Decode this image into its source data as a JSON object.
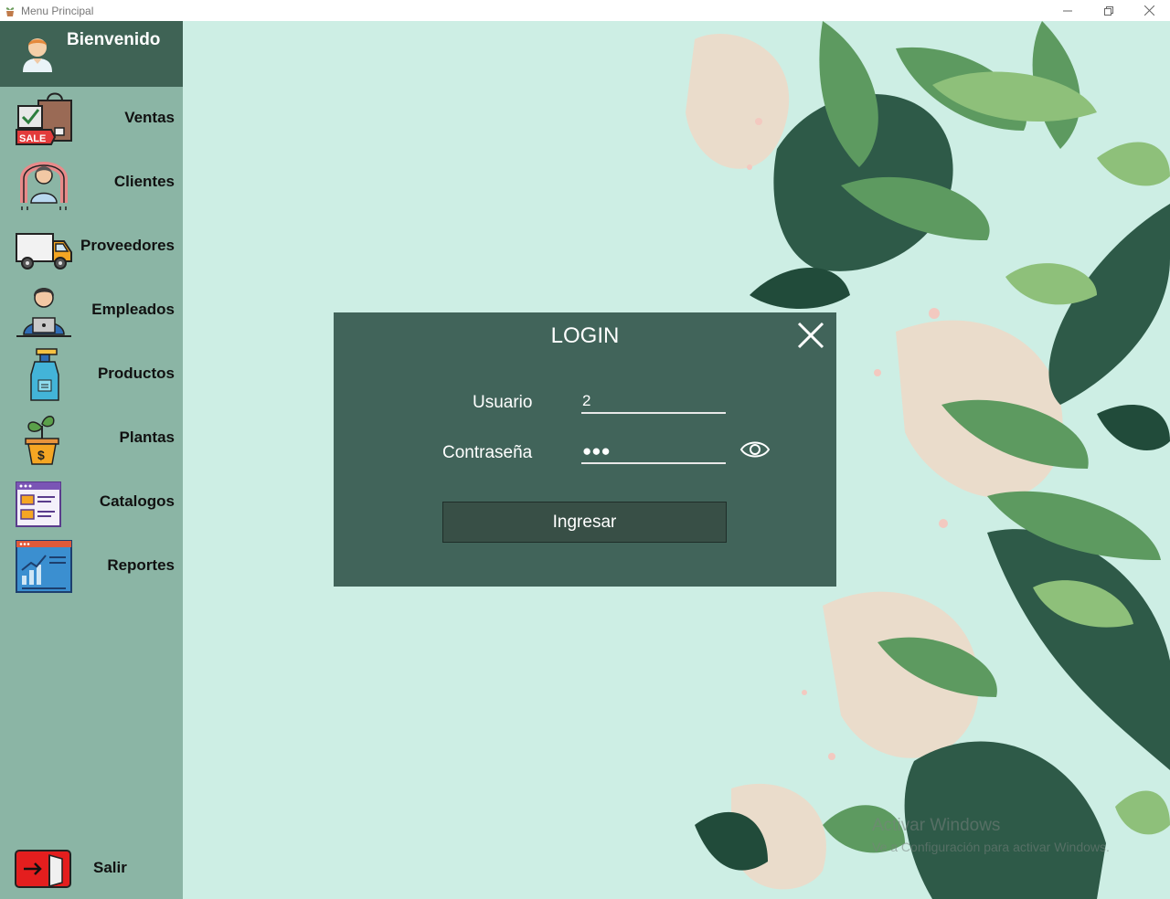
{
  "window": {
    "title": "Menu Principal",
    "minimize_icon": "minimize-icon",
    "maximize_icon": "restore-icon",
    "close_icon": "close-icon"
  },
  "sidebar": {
    "welcome": "Bienvenido",
    "items": [
      {
        "label": "Ventas",
        "icon": "sale-bag-icon"
      },
      {
        "label": "Clientes",
        "icon": "customer-icon"
      },
      {
        "label": "Proveedores",
        "icon": "delivery-truck-icon"
      },
      {
        "label": "Empleados",
        "icon": "employee-icon"
      },
      {
        "label": "Productos",
        "icon": "spray-bottle-icon"
      },
      {
        "label": "Plantas",
        "icon": "plant-pot-icon"
      },
      {
        "label": "Catalogos",
        "icon": "catalog-icon"
      },
      {
        "label": "Reportes",
        "icon": "report-chart-icon"
      }
    ],
    "exit": {
      "label": "Salir",
      "icon": "exit-door-icon"
    }
  },
  "login": {
    "title": "LOGIN",
    "user_label": "Usuario",
    "user_value": "2",
    "password_label": "Contraseña",
    "password_value": "●●●",
    "submit_label": "Ingresar"
  },
  "watermark": {
    "line1": "Activar Windows",
    "line2": "Ve a Configuración para activar Windows."
  },
  "colors": {
    "sidebar_bg": "#8bb5a5",
    "sidebar_header_bg": "#3f6355",
    "main_bg": "#cdeee4",
    "dialog_bg": "#41645a",
    "button_bg": "#384f46"
  }
}
